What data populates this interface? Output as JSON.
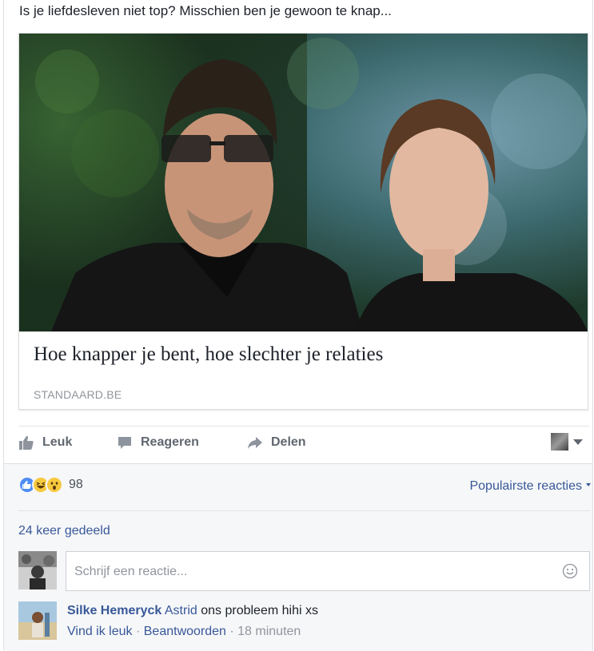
{
  "post": {
    "text": "Is je liefdesleven niet top? Misschien ben je gewoon te knap..."
  },
  "link_card": {
    "title": "Hoe knapper je bent, hoe slechter je relaties",
    "domain": "STANDAARD.BE",
    "image_icon": "photo-image"
  },
  "actions": {
    "like_label": "Leuk",
    "comment_label": "Reageren",
    "share_label": "Delen"
  },
  "reactions": {
    "count": "98",
    "types": [
      "like",
      "haha",
      "wow"
    ],
    "sort_label": "Populairste reacties"
  },
  "shares": {
    "text": "24 keer gedeeld"
  },
  "comment_input": {
    "placeholder": "Schrijf een reactie...",
    "value": ""
  },
  "comments": [
    {
      "author": "Silke Hemeryck",
      "tag": "Astrid",
      "text": " ons probleem hihi xs",
      "like_label": "Vind ik leuk",
      "reply_label": "Beantwoorden",
      "time": "18 minuten",
      "separator": " · "
    }
  ],
  "colors": {
    "link_blue": "#385898",
    "text_dark": "#1d2129",
    "muted_gray": "#90949c",
    "action_gray": "#616770",
    "panel_bg": "#f6f7f9"
  }
}
